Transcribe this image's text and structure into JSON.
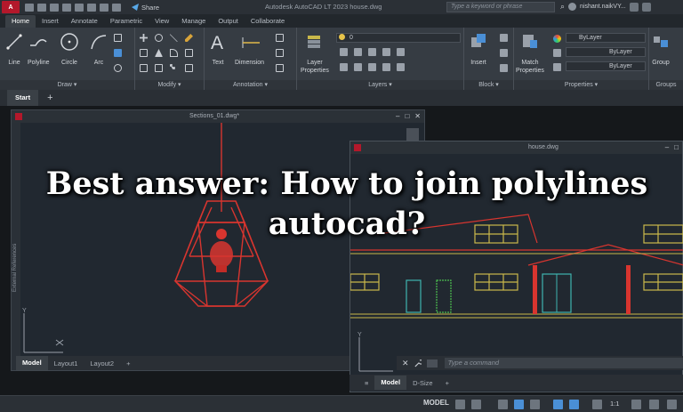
{
  "titlebar": {
    "app_logo": "A",
    "share_label": "Share",
    "app_title": "Autodesk AutoCAD LT 2023    house.dwg",
    "search_placeholder": "Type a keyword or phrase",
    "user_name": "nishant.naikVY..."
  },
  "ribbon_tabs": [
    "Home",
    "Insert",
    "Annotate",
    "Parametric",
    "View",
    "Manage",
    "Output",
    "Collaborate"
  ],
  "ribbon": {
    "draw": {
      "tools": [
        "Line",
        "Polyline",
        "Circle",
        "Arc"
      ],
      "footer": "Draw ▾"
    },
    "modify": {
      "footer": "Modify ▾"
    },
    "annotation": {
      "tools": [
        "Text",
        "Dimension"
      ],
      "footer": "Annotation ▾"
    },
    "layers": {
      "tool": "Layer\nProperties",
      "layer_value": "0",
      "footer": "Layers ▾"
    },
    "block": {
      "tool": "Insert",
      "footer": "Block ▾"
    },
    "properties": {
      "tool": "Match\nProperties",
      "combo1": "ByLayer",
      "combo2": "ByLayer",
      "combo3": "ByLayer",
      "footer": "Properties ▾"
    },
    "groups": {
      "tool": "Group",
      "footer": "Groups"
    }
  },
  "file_tabs": {
    "start": "Start",
    "plus": "+"
  },
  "win1": {
    "title": "Sections_01.dwg*",
    "side_label": "External References",
    "axis_y": "Y",
    "layout_tabs": [
      "Model",
      "Layout1",
      "Layout2"
    ],
    "layout_plus": "+"
  },
  "win2": {
    "title": "house.dwg",
    "axis_y": "Y",
    "layout_tabs": [
      "Model",
      "D-Size"
    ],
    "layout_plus": "+"
  },
  "command": {
    "placeholder": "Type a command"
  },
  "statusbar": {
    "model": "MODEL",
    "scale": "1:1"
  },
  "headline": {
    "line1": "Best answer: How to join polylines",
    "line2": "autocad?"
  },
  "colors": {
    "accent_red": "#b3182b",
    "lamp_red": "#d8352f",
    "drawing_teal": "#3fb5b0",
    "drawing_green": "#4bbf4f",
    "drawing_yellow": "#c9b84a"
  }
}
